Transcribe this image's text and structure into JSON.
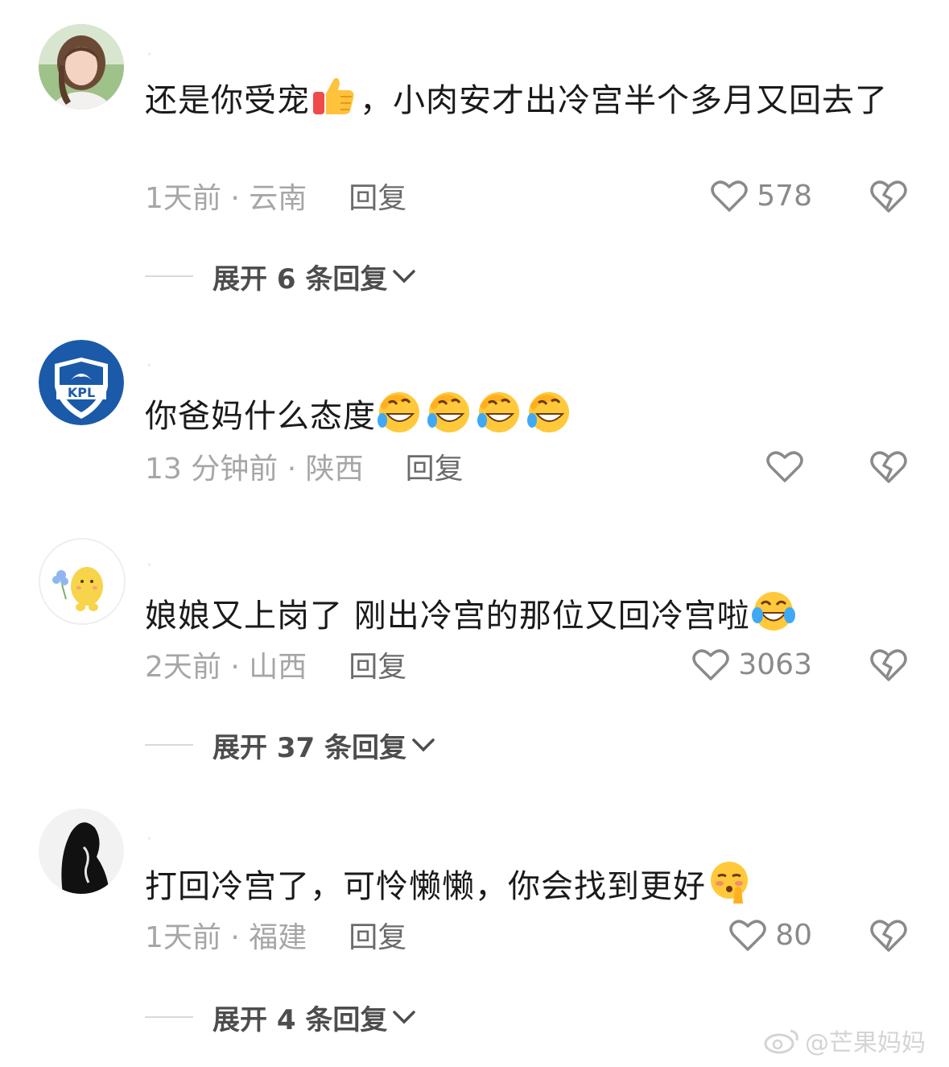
{
  "comments": [
    {
      "text": "还是你受宠",
      "emoji": "thumbs-up-emoji",
      "text_after": "，小肉安才出冷宫半个多月又回去了",
      "time": "1天前 · 云南",
      "reply_label": "回复",
      "likes": "578",
      "expand_label": "展开 6 条回复"
    },
    {
      "text": "你爸妈什么态度",
      "emoji": "rolling-laughing-emoji",
      "emoji_count": 4,
      "time": "13 分钟前 · 陕西",
      "reply_label": "回复",
      "likes": ""
    },
    {
      "text": "娘娘又上岗了 刚出冷宫的那位又回冷宫啦",
      "emoji": "tears-of-joy-emoji",
      "time": "2天前 · 山西",
      "reply_label": "回复",
      "likes": "3063",
      "expand_label": "展开 37 条回复"
    },
    {
      "text": "打回冷宫了，可怜懒懒，你会找到更好",
      "emoji": "shushing-face-emoji",
      "time": "1天前 · 福建",
      "reply_label": "回复",
      "likes": "80",
      "expand_label": "展开 4 条回复"
    }
  ],
  "watermark": "@芒果妈妈",
  "colors": {
    "text": "#1a1a1a",
    "meta": "#a6a6a6",
    "reply": "#6b6b6b",
    "expand": "#4d4d4d",
    "kpl_blue": "#1b5aa8"
  }
}
